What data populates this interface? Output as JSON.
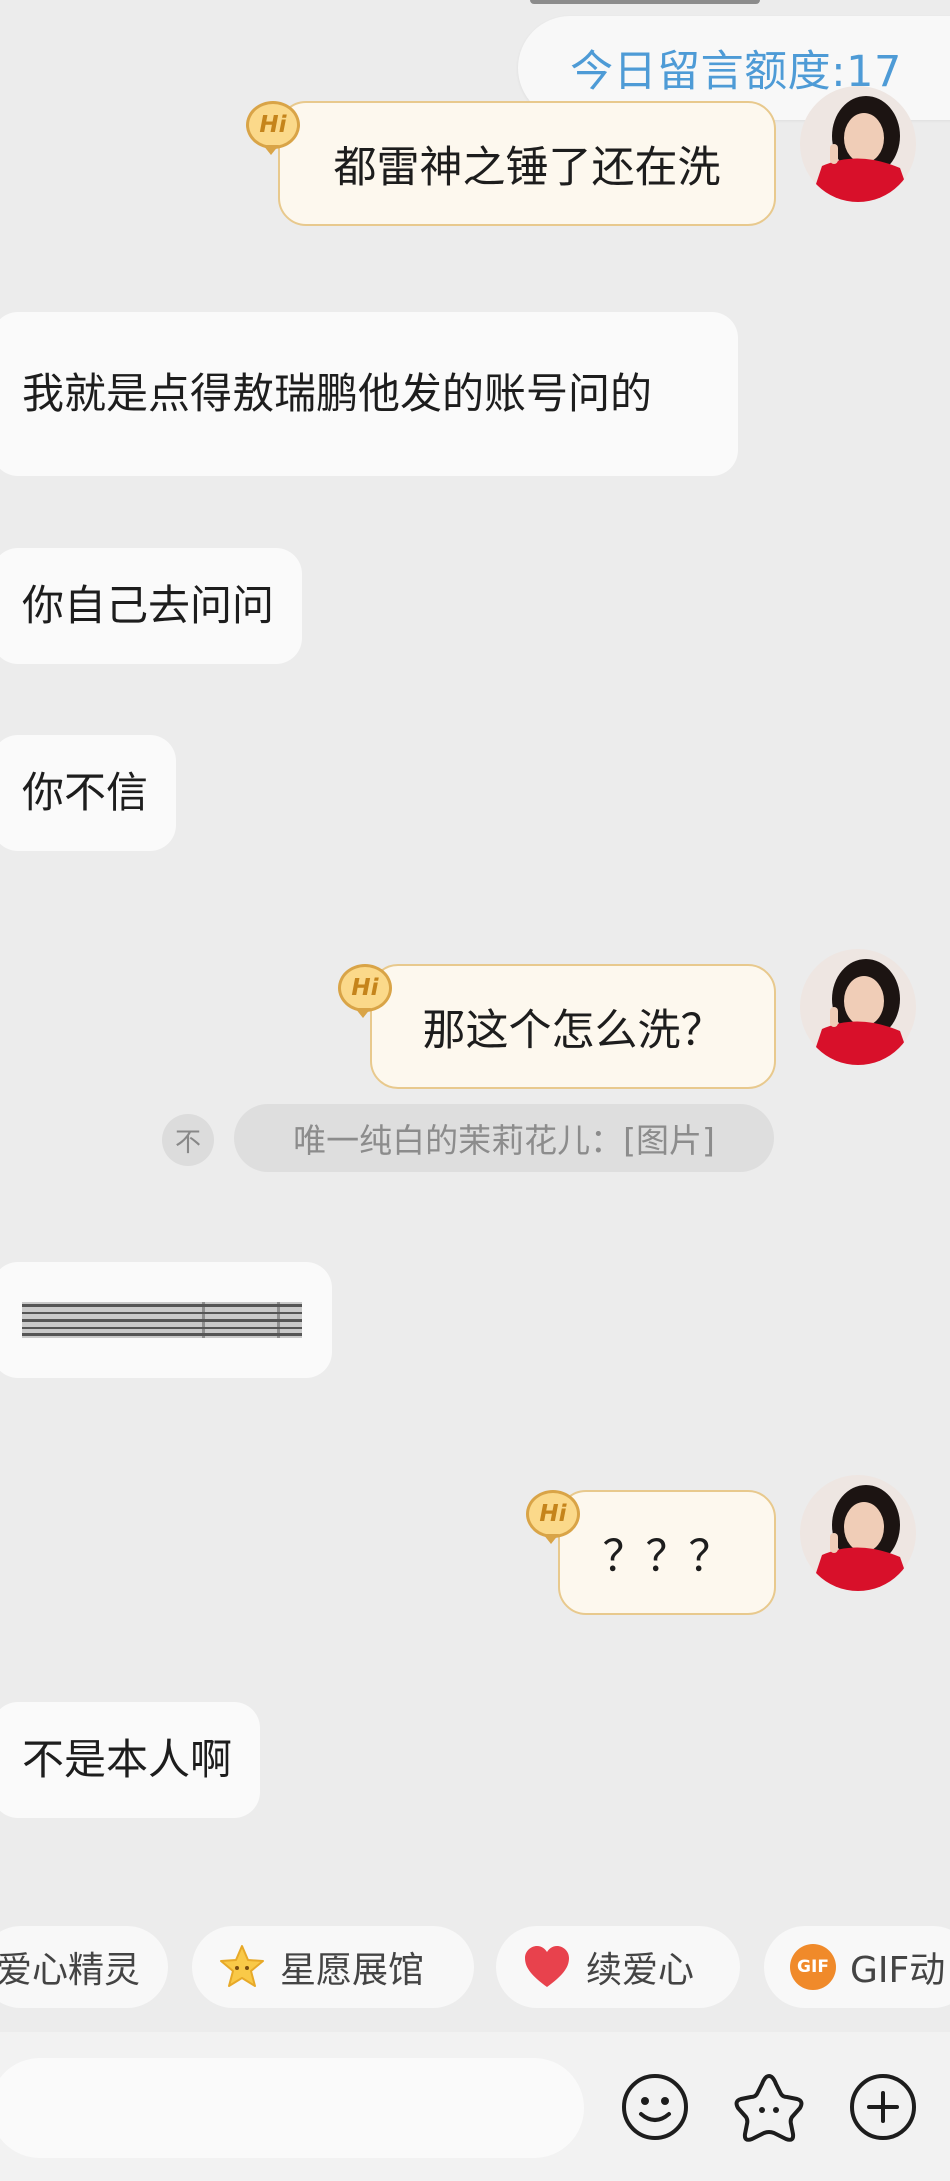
{
  "quota": {
    "label": "今日留言额度:17"
  },
  "messages": [
    {
      "side": "out",
      "text": "都雷神之锤了还在洗",
      "badge": "Hi"
    },
    {
      "side": "in",
      "text": "我就是点得敖瑞鹏他发的账号问的"
    },
    {
      "side": "in",
      "text": "你自己去问问"
    },
    {
      "side": "in",
      "text": "你不信"
    },
    {
      "side": "out",
      "text": "那这个怎么洗？",
      "badge": "Hi"
    },
    {
      "side": "in",
      "text": "",
      "note": "blurred barcode-like image"
    },
    {
      "side": "out",
      "text": "？？？",
      "badge": "Hi"
    },
    {
      "side": "in",
      "text": "不是本人啊"
    }
  ],
  "recall": {
    "icon": "recall-arrow-icon",
    "glyph": "不",
    "text": "唯一纯白的茉莉花儿：[图片]"
  },
  "chips": [
    {
      "label": "爱心精灵",
      "icon": "none"
    },
    {
      "label": "星愿展馆",
      "icon": "star-face-icon"
    },
    {
      "label": "续爱心",
      "icon": "heart-icon"
    },
    {
      "label": "GIF动",
      "icon": "gif-icon",
      "icon_text": "GIF"
    }
  ],
  "toolbar": {
    "icons": [
      "emoji-icon",
      "favorite-star-icon",
      "add-circle-icon"
    ]
  },
  "colors": {
    "background": "#ececec",
    "out_bubble": "#fdf8ee",
    "out_border": "#e8c98d",
    "in_bubble": "#fafafa",
    "quota_text": "#4e9bd6",
    "heart": "#e8424d"
  }
}
